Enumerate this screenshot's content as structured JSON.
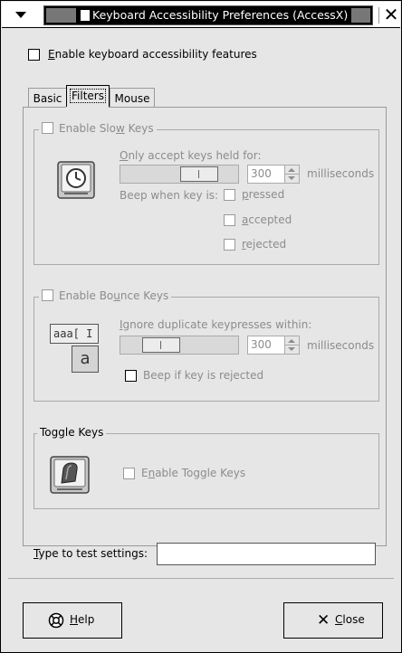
{
  "window": {
    "title": "Keyboard Accessibility Preferences (AccessX)"
  },
  "enable_features": {
    "label_prefix": "",
    "label_mnemonic": "E",
    "label_rest": "nable keyboard accessibility features",
    "checked": false
  },
  "tabs": [
    {
      "label": "Basic",
      "active": false
    },
    {
      "label": "Filters",
      "active": true
    },
    {
      "label": "Mouse",
      "active": false
    }
  ],
  "slow_keys": {
    "frame_label_a": "Enable Slo",
    "frame_label_m": "w",
    "frame_label_b": " Keys",
    "held_label_a": "",
    "held_label_m": "O",
    "held_label_b": "nly accept keys held for:",
    "value": "300",
    "unit": "milliseconds",
    "beep_label": "Beep when key is:",
    "opt_pressed_m": "p",
    "opt_pressed_b": "ressed",
    "opt_accepted_m": "a",
    "opt_accepted_b": "ccepted",
    "opt_rejected_m": "r",
    "opt_rejected_b": "ejected"
  },
  "bounce_keys": {
    "frame_label_a": "Enable Bo",
    "frame_label_m": "u",
    "frame_label_b": "nce Keys",
    "ignore_label_a": "",
    "ignore_label_m": "I",
    "ignore_label_b": "gnore duplicate keypresses within:",
    "value": "300",
    "unit": "milliseconds",
    "beep_label_a": "Beep if key is re",
    "beep_label_m": "j",
    "beep_label_b": "ected",
    "icon_text": "aaa[ I",
    "icon_letter": "a"
  },
  "toggle_keys": {
    "frame_label": "Toggle Keys",
    "enable_a": "E",
    "enable_m": "n",
    "enable_b": "able Toggle Keys"
  },
  "test": {
    "label_m": "T",
    "label_b": "ype to test settings:",
    "value": ""
  },
  "buttons": {
    "help_m": "H",
    "help_b": "elp",
    "close_m": "C",
    "close_b": "lose"
  }
}
